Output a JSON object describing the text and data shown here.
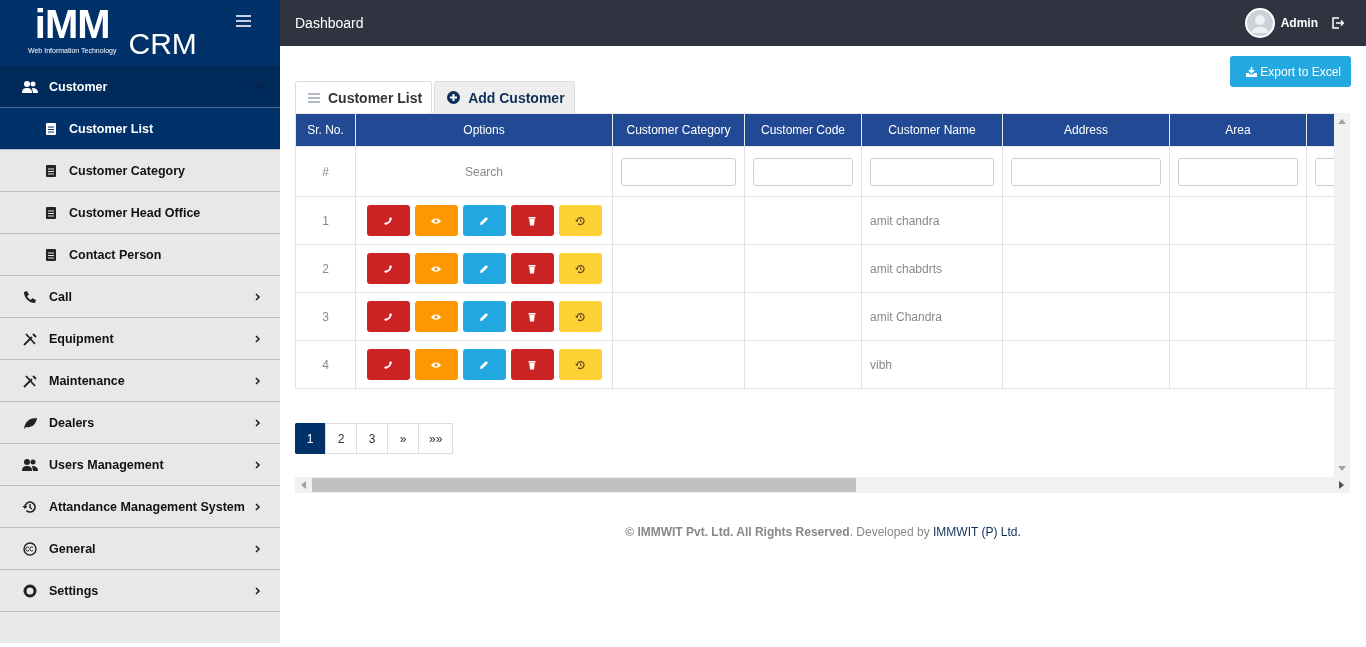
{
  "logo": {
    "mark": "iMM",
    "tagline": "Web Information Technology",
    "product": "CRM"
  },
  "sidebar": {
    "items": [
      {
        "label": "Customer",
        "expanded": true,
        "children": [
          {
            "label": "Customer List",
            "selected": true
          },
          {
            "label": "Customer Category",
            "selected": false
          },
          {
            "label": "Customer Head Office",
            "selected": false
          },
          {
            "label": "Contact Person",
            "selected": false
          }
        ]
      },
      {
        "label": "Call",
        "expanded": false
      },
      {
        "label": "Equipment",
        "expanded": false
      },
      {
        "label": "Maintenance",
        "expanded": false
      },
      {
        "label": "Dealers",
        "expanded": false
      },
      {
        "label": "Users Management",
        "expanded": false
      },
      {
        "label": "Attandance Management System",
        "expanded": false
      },
      {
        "label": "General",
        "expanded": false
      },
      {
        "label": "Settings",
        "expanded": false
      }
    ]
  },
  "topbar": {
    "title": "Dashboard",
    "user": "Admin"
  },
  "export_button": "Export to Excel",
  "tabs": [
    {
      "label": "Customer List",
      "selected": true
    },
    {
      "label": "Add Customer",
      "selected": false
    }
  ],
  "table": {
    "columns": [
      "Sr. No.",
      "Options",
      "Customer Category",
      "Customer Code",
      "Customer Name",
      "Address",
      "Area",
      ""
    ],
    "filter_row": {
      "sr": "#",
      "options": "Search"
    },
    "rows": [
      {
        "sr": "1",
        "customer_name": "amit chandra"
      },
      {
        "sr": "2",
        "customer_name": "amit chabdrts"
      },
      {
        "sr": "3",
        "customer_name": "amit Chandra"
      },
      {
        "sr": "4",
        "customer_name": "vibh"
      }
    ]
  },
  "pagination": [
    {
      "label": "1",
      "selected": true
    },
    {
      "label": "2",
      "selected": false
    },
    {
      "label": "3",
      "selected": false
    },
    {
      "label": "»",
      "selected": false
    },
    {
      "label": "»»",
      "selected": false
    }
  ],
  "footer": {
    "text": "**© IMMWIT Pvt. Ltd. All Rights Reserved**. Developed by ",
    "link": "IMMWIT (P) Ltd."
  }
}
